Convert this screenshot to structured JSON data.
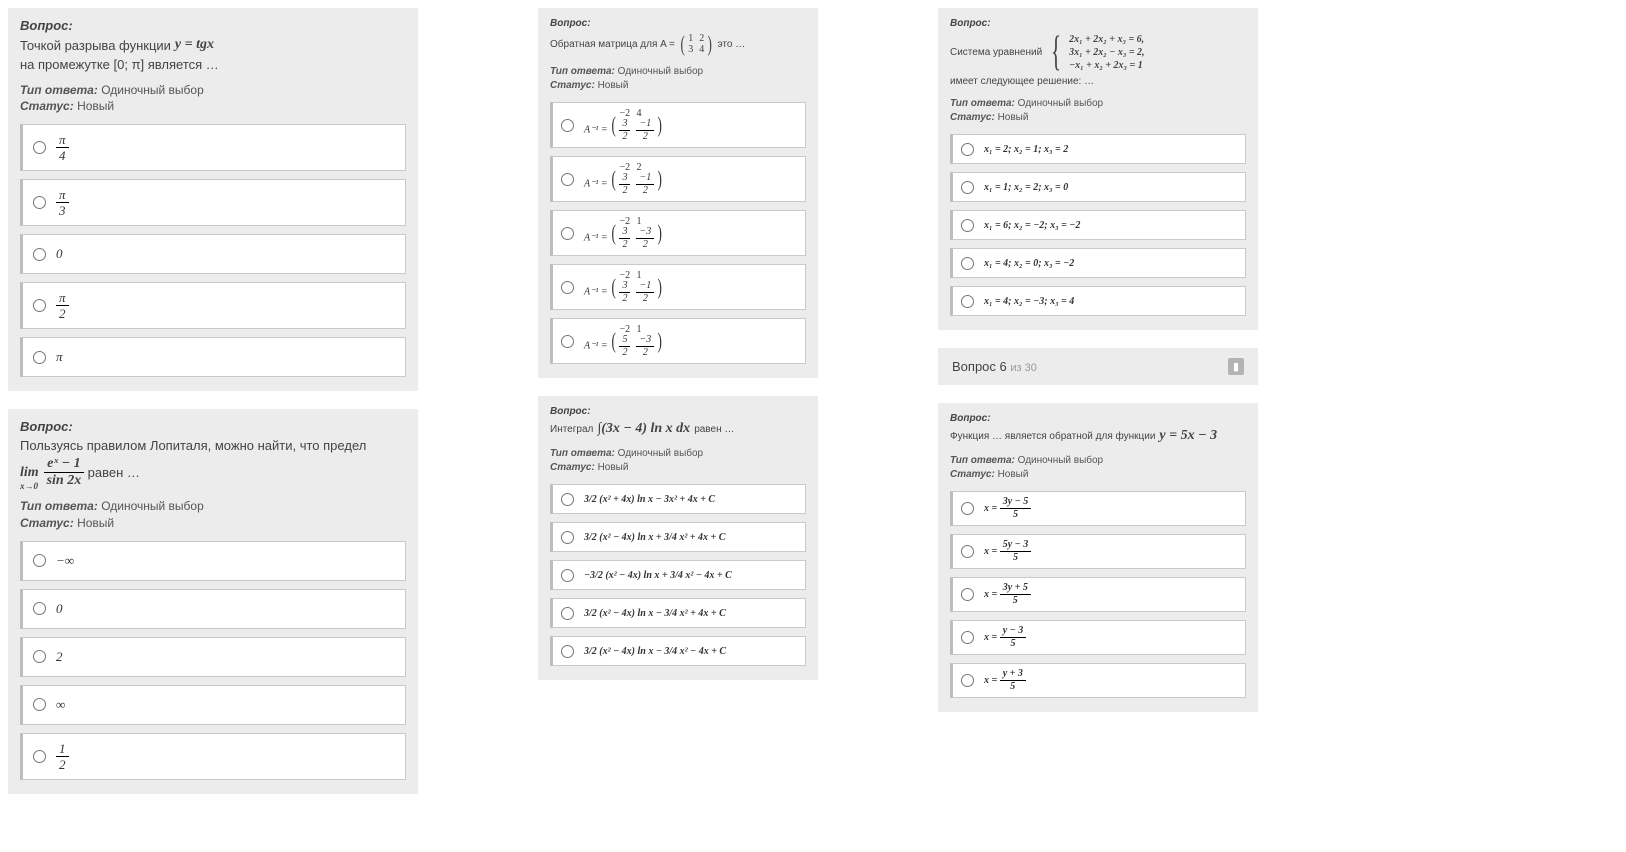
{
  "labels": {
    "question": "Вопрос:",
    "ansType": "Тип ответа:",
    "ansTypeVal": "Одиночный выбор",
    "status": "Статус:",
    "statusVal": "Новый"
  },
  "col1": {
    "q1": {
      "pre": "Точкой разрыва функции",
      "formula": "y = tgx",
      "post": "на промежутке [0; π] является …",
      "options": [
        "π/4",
        "π/3",
        "0",
        "π/2",
        "π"
      ]
    },
    "q2": {
      "pre": "Пользуясь правилом Лопиталя, можно найти, что предел",
      "formula": "lim_{x→0} (eˣ − 1) / sin 2x",
      "post": "равен …",
      "options": [
        "−∞",
        "0",
        "2",
        "∞",
        "1/2"
      ]
    }
  },
  "col2": {
    "q3": {
      "pre": "Обратная матрица для A =",
      "matrix": [
        [
          "1",
          "2"
        ],
        [
          "3",
          "4"
        ]
      ],
      "post": "это …",
      "options": [
        "A⁻¹ = ( −2  4 ;  3/2  −1/2 )",
        "A⁻¹ = ( −2  2 ;  3/2  −1/2 )",
        "A⁻¹ = ( −2  1 ;  3/2  −3/2 )",
        "A⁻¹ = ( −2  1 ;  3/2  −1/2 )",
        "A⁻¹ = ( −2  1 ;  5/2  −3/2 )"
      ],
      "option_matrices": [
        [
          [
            "−2",
            "4"
          ],
          [
            "3/2",
            "−1/2"
          ]
        ],
        [
          [
            "−2",
            "2"
          ],
          [
            "3/2",
            "−1/2"
          ]
        ],
        [
          [
            "−2",
            "1"
          ],
          [
            "3/2",
            "−3/2"
          ]
        ],
        [
          [
            "−2",
            "1"
          ],
          [
            "3/2",
            "−1/2"
          ]
        ],
        [
          [
            "−2",
            "1"
          ],
          [
            "5/2",
            "−3/2"
          ]
        ]
      ]
    },
    "q4": {
      "pre": "Интеграл",
      "formula": "∫(3x − 4) ln x dx",
      "post": "равен …",
      "options": [
        "3/2 (x² + 4x) ln x − 3x² + 4x + C",
        "3/2 (x² − 4x) ln x + 3/4 x² + 4x + C",
        "−3/2 (x² − 4x) ln x + 3/4 x² − 4x + C",
        "3/2 (x² − 4x) ln x − 3/4 x² + 4x + C",
        "3/2 (x² − 4x) ln x − 3/4 x² − 4x + C"
      ]
    }
  },
  "col3": {
    "q5": {
      "pre": "Система уравнений",
      "eqs": [
        "2x₁ + 2x₂ + x₃ = 6,",
        "3x₁ + 2x₂ − x₃ = 2,",
        "−x₁ + x₂ + 2x₃ = 1"
      ],
      "post": "имеет следующее решение: …",
      "options": [
        "x₁ = 2;  x₂ = 1;  x₃ = 2",
        "x₁ = 1;  x₂ = 2;  x₃ = 0",
        "x₁ = 6;  x₂ = −2;  x₃ = −2",
        "x₁ = 4;  x₂ = 0;  x₃ = −2",
        "x₁ = 4;  x₂ = −3;  x₃ = 4"
      ]
    },
    "nav": {
      "text": "Вопрос 6",
      "of": "из 30"
    },
    "q6": {
      "pre": "Функция … является обратной для функции",
      "formula": "y = 5x − 3",
      "options": [
        "x = (3y − 5) / 5",
        "x = (5y − 3) / 5",
        "x = (3y + 5) / 5",
        "x = (y − 3) / 5",
        "x = (y + 3) / 5"
      ],
      "option_fracs": [
        {
          "num": "3y − 5",
          "den": "5"
        },
        {
          "num": "5y − 3",
          "den": "5"
        },
        {
          "num": "3y + 5",
          "den": "5"
        },
        {
          "num": "y − 3",
          "den": "5"
        },
        {
          "num": "y + 3",
          "den": "5"
        }
      ]
    }
  }
}
